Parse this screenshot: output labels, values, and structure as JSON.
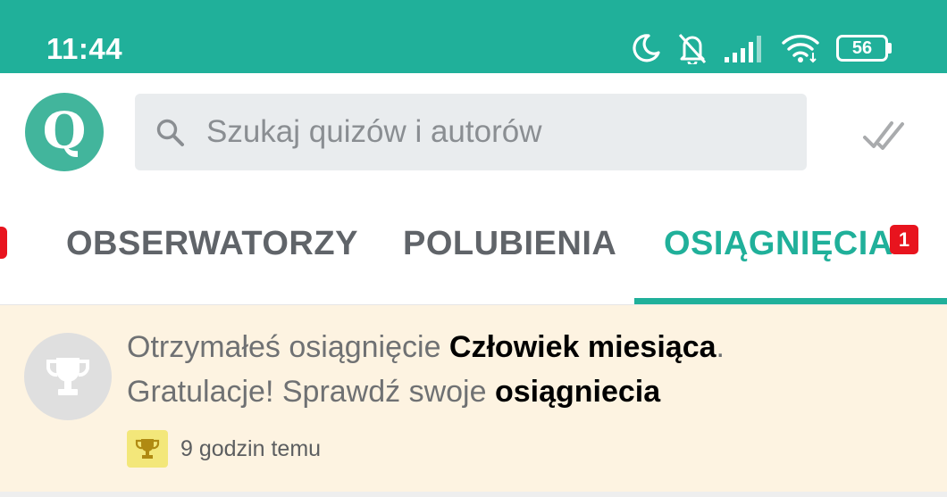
{
  "status_bar": {
    "time": "11:44",
    "battery_level": "56",
    "icons": [
      "moon-icon",
      "bell-off-icon",
      "signal-icon",
      "wifi-icon",
      "battery-icon"
    ],
    "background": "#20b09a"
  },
  "header": {
    "logo_letter": "Q",
    "search_placeholder": "Szukaj quizów i autorów",
    "search_value": "",
    "icons": [
      "search-icon",
      "double-check-icon"
    ]
  },
  "tabs": {
    "items": [
      {
        "label": "OBSERWATORZY",
        "active": false
      },
      {
        "label": "POLUBIENIA",
        "active": false
      },
      {
        "label": "OSIĄGNIĘCIA",
        "active": true,
        "badge": "1"
      }
    ],
    "accent": "#20b09a",
    "badge_color": "#e8141e"
  },
  "notification": {
    "line1_prefix": "Otrzymałeś osiągnięcie ",
    "achievement_name": "Człowiek miesiąca",
    "line1_suffix": ".",
    "line2_prefix": "Gratulacje! Sprawdź swoje ",
    "line2_link": "osiągniecia",
    "time": "9 godzin temu",
    "icons": [
      "trophy-icon"
    ],
    "background": "#fdf3e1"
  }
}
